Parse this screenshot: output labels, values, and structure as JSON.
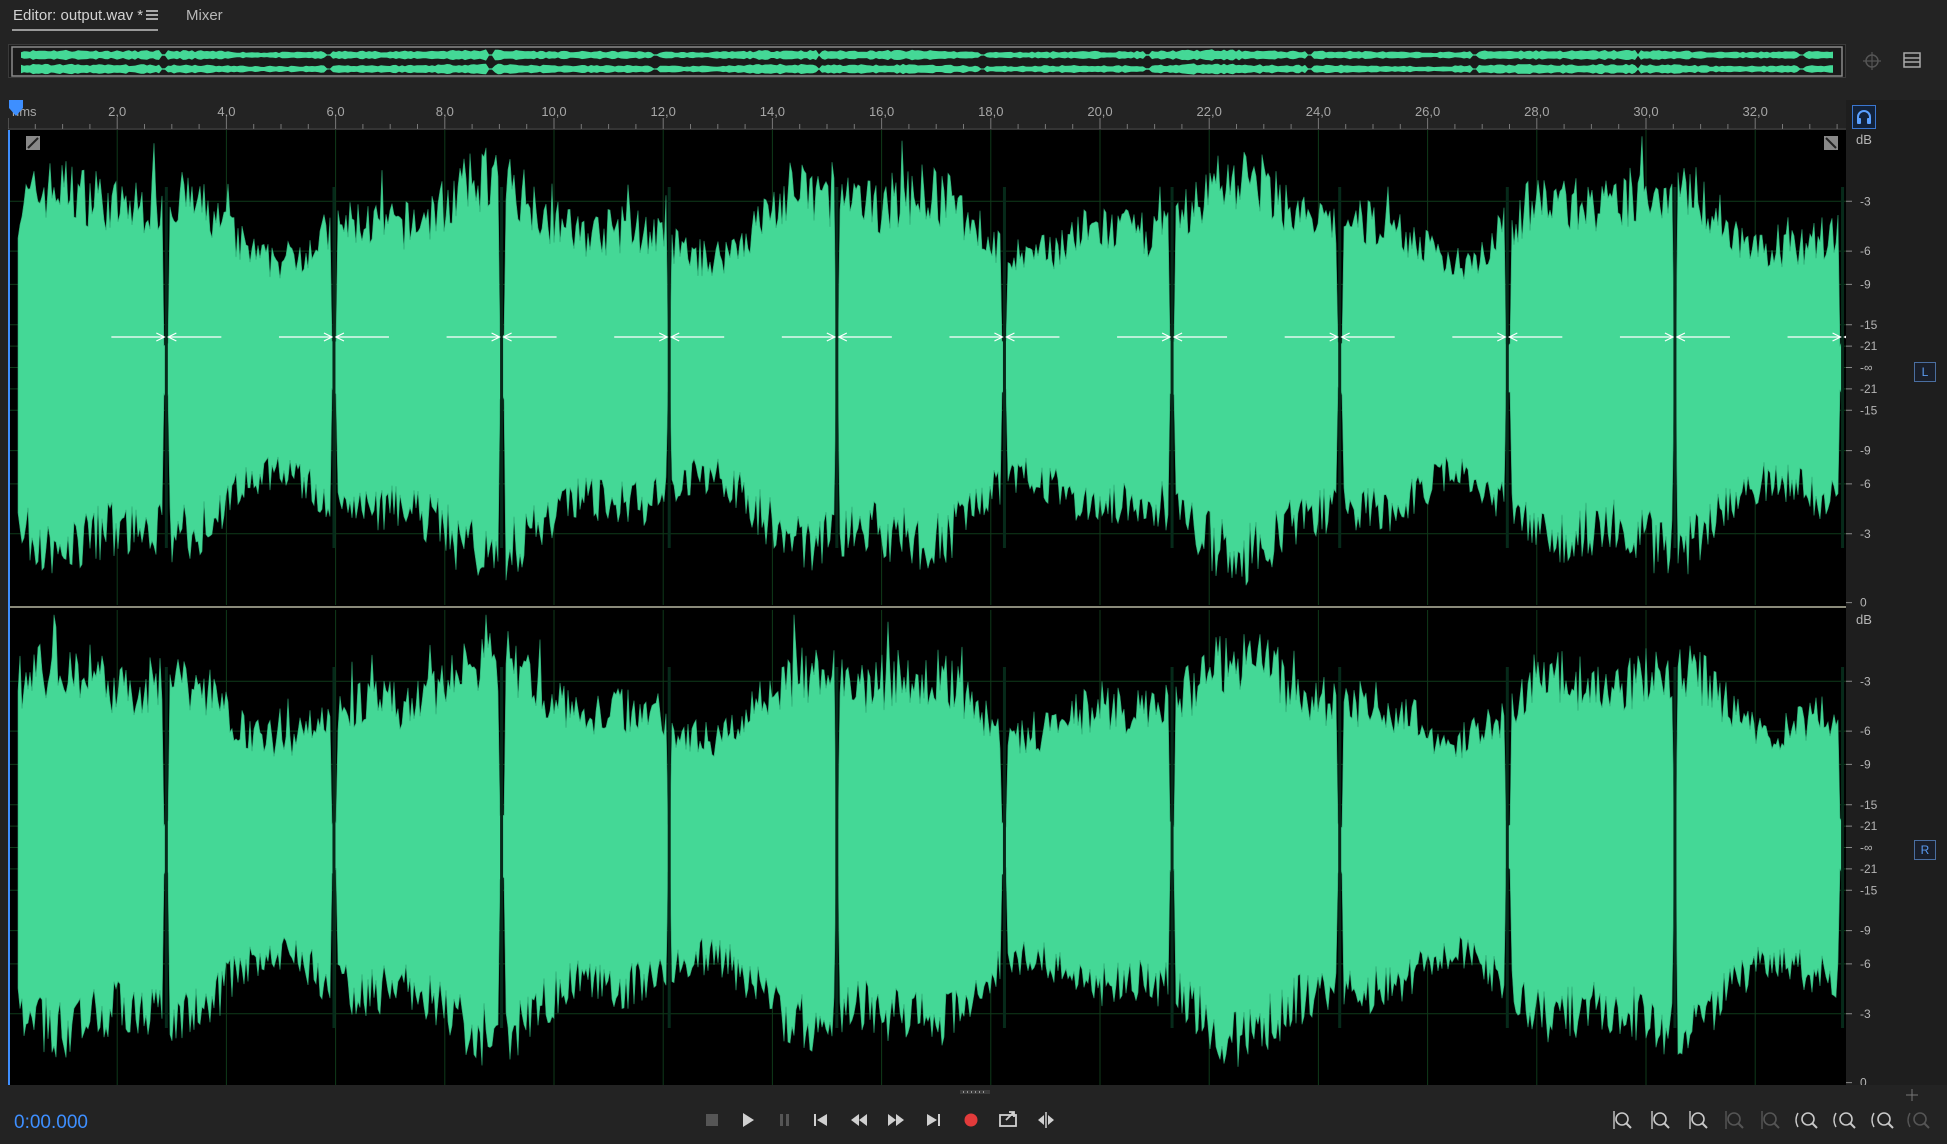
{
  "tabs": [
    {
      "label": "Editor: output.wav *",
      "active": true
    },
    {
      "label": "Mixer",
      "active": false
    }
  ],
  "icons": {
    "tab_menu": "hamburger-menu-icon",
    "overview_zoom": "zoom-target-icon",
    "overview_panel": "panel-list-icon",
    "headphones": "headphones-icon"
  },
  "ruler": {
    "unit_label": "hms",
    "ticks": [
      "2,0",
      "4,0",
      "6,0",
      "8,0",
      "10,0",
      "12,0",
      "14,0",
      "16,0",
      "18,0",
      "20,0",
      "22,0",
      "24,0",
      "26,0",
      "28,0",
      "30,0",
      "32,0"
    ]
  },
  "channels": [
    {
      "label": "L",
      "db_title": "dB",
      "db_ticks": [
        "-3",
        "-6",
        "-9",
        "-15",
        "-21",
        "-∞",
        "-21",
        "-15",
        "-9",
        "-6",
        "-3",
        "0"
      ]
    },
    {
      "label": "R",
      "db_title": "dB",
      "db_ticks": [
        "-3",
        "-6",
        "-9",
        "-15",
        "-21",
        "-∞",
        "-21",
        "-15",
        "-9",
        "-6",
        "-3",
        "0"
      ]
    }
  ],
  "transport": {
    "timecode": "0:00.000",
    "buttons": [
      "stop",
      "play",
      "pause",
      "go-to-start",
      "rewind",
      "fast-forward",
      "go-to-end",
      "record",
      "loop-export",
      "skip-selection"
    ]
  },
  "zoom_tools": [
    "zoom-in-amplitude",
    "zoom-out-amplitude",
    "zoom-in-time",
    "zoom-out-time",
    "zoom-reset",
    "zoom-full",
    "zoom-in",
    "zoom-out",
    "zoom-selection"
  ],
  "colors": {
    "waveform": "#44d896",
    "waveform_bg": "#000000",
    "grid": "#0f3a1a",
    "accent": "#3e8fff",
    "record": "#e23b3b",
    "ruler_text": "#a6a6a6"
  }
}
